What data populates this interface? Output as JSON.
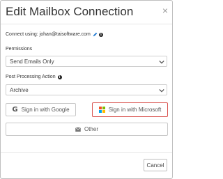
{
  "dialog": {
    "title": "Edit Mailbox Connection",
    "close_glyph": "×"
  },
  "connect": {
    "text": "Connect using: johan@taisoftware.com",
    "edit_icon": "pencil-icon",
    "info_icon": "info-icon"
  },
  "permissions": {
    "label": "Permissions",
    "selected": "Send Emails Only"
  },
  "post_processing": {
    "label": "Post Processing Action",
    "info_icon": "info-icon",
    "selected": "Archive"
  },
  "buttons": {
    "google": "Sign in with Google",
    "microsoft": "Sign in with Microsoft",
    "other": "Other"
  },
  "footer": {
    "cancel": "Cancel"
  },
  "colors": {
    "highlight_border": "#d9534f",
    "pencil": "#2a7fd4",
    "ms_red": "#f25022",
    "ms_green": "#7fba00",
    "ms_blue": "#00a4ef",
    "ms_yellow": "#ffb900"
  }
}
